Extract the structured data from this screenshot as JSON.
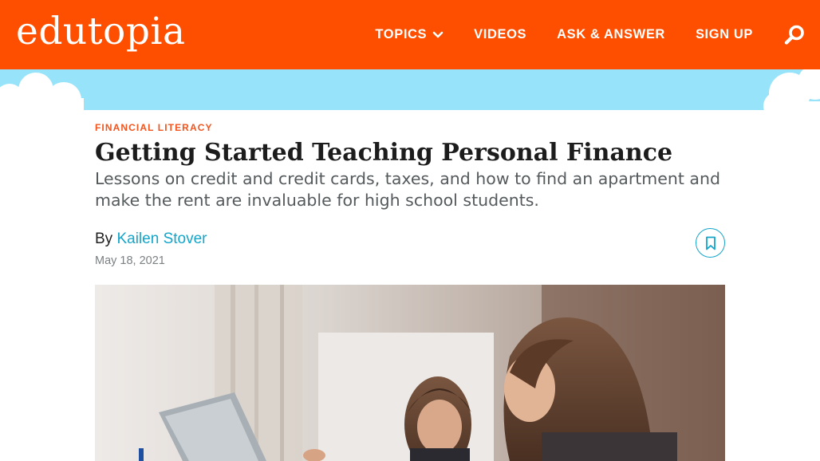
{
  "header": {
    "logo_text": "edutopia",
    "nav": {
      "topics": "TOPICS",
      "videos": "VIDEOS",
      "ask_answer": "ASK & ANSWER",
      "sign_up": "SIGN UP"
    },
    "icons": {
      "dropdown": "chevron-down-icon",
      "search": "search-icon"
    }
  },
  "article": {
    "category": "FINANCIAL LITERACY",
    "title": "Getting Started Teaching Personal Finance",
    "subtitle": "Lessons on credit and credit cards, taxes, and how to find an apartment and make the rent are invaluable for high school students.",
    "byline_prefix": "By",
    "author": "Kailen Stover",
    "date": "May 18, 2021",
    "bookmark_icon": "bookmark-icon"
  },
  "colors": {
    "header_bg": "#fe4f00",
    "sky_bg": "#97e3f9",
    "category": "#f2541e",
    "author_link": "#14a5c9",
    "title": "#1c1c1c",
    "subtitle": "#555a5d"
  }
}
